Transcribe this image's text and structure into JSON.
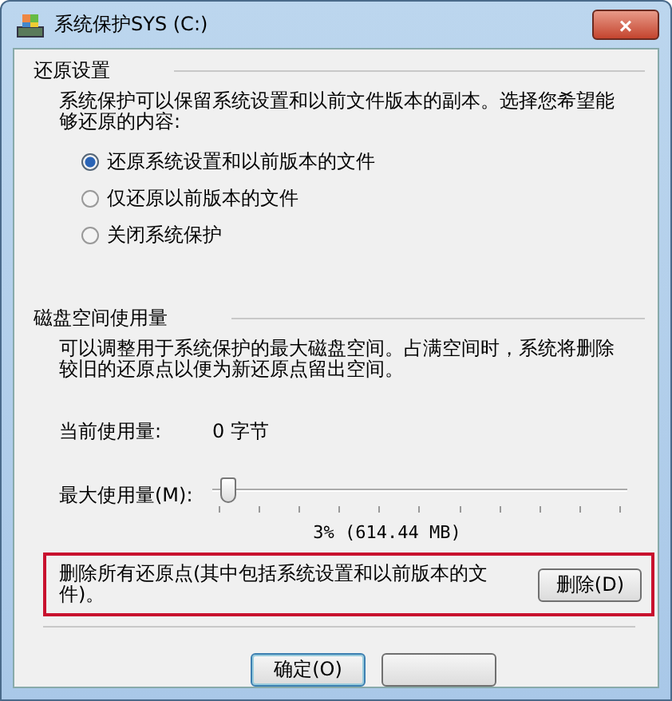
{
  "window": {
    "title": "系统保护SYS (C:)",
    "close": "×"
  },
  "restore_settings": {
    "heading": "还原设置",
    "description": "系统保护可以保留系统设置和以前文件版本的副本。选择您希望能够还原的内容:",
    "options": [
      {
        "label": "还原系统设置和以前版本的文件",
        "selected": true
      },
      {
        "label": "仅还原以前版本的文件",
        "selected": false
      },
      {
        "label": "关闭系统保护",
        "selected": false
      }
    ]
  },
  "disk_usage": {
    "heading": "磁盘空间使用量",
    "description": "可以调整用于系统保护的最大磁盘空间。占满空间时，系统将删除较旧的还原点以便为新还原点留出空间。",
    "current_label": "当前使用量:",
    "current_value": "0 字节",
    "max_label": "最大使用量(M):",
    "slider": {
      "level": 0.03
    },
    "reading": "3% (614.44 MB)"
  },
  "delete": {
    "text": "删除所有还原点(其中包括系统设置和以前版本的文件)。",
    "button": "删除(D)"
  },
  "buttons": [
    {
      "label": "确定(O)",
      "default": true
    },
    {
      "default": false
    }
  ]
}
